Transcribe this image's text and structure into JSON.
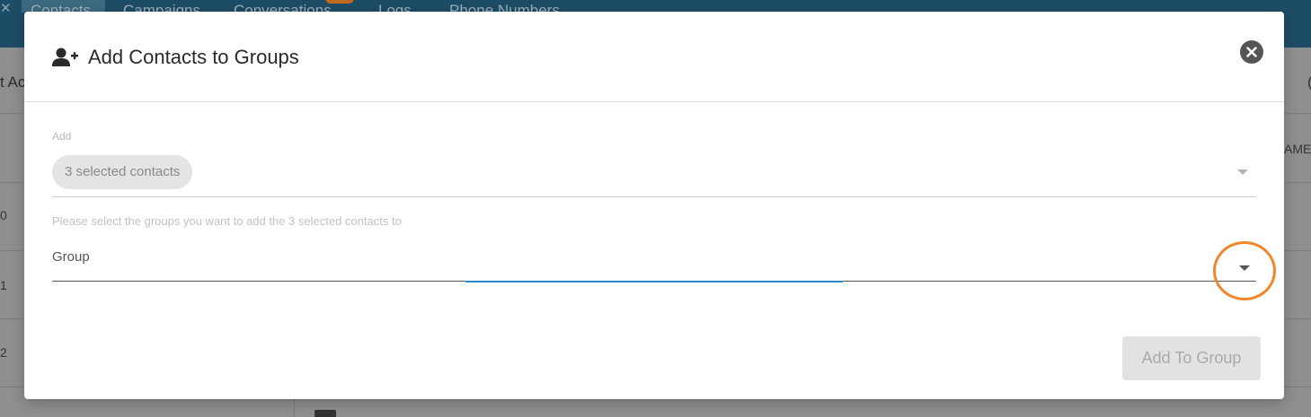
{
  "background": {
    "nav": [
      "Contacts",
      "Campaigns",
      "Conversations",
      "Logs",
      "Phone Numbers"
    ],
    "left_fragment": "t Ac",
    "right_fragment": "AME",
    "row_numbers": [
      "0",
      "1",
      "2"
    ],
    "right_edge_fragment": "("
  },
  "modal": {
    "title": "Add Contacts to Groups",
    "header_icon": "user-plus-icon",
    "close_icon": "close-icon",
    "add_label": "Add",
    "selected_chip": "3 selected contacts",
    "helper_text": "Please select the groups you want to add the 3 selected contacts to",
    "group_label": "Group",
    "submit_label": "Add To Group"
  },
  "colors": {
    "nav_bar": "#1d4d66",
    "focus_accent": "#2e86c8",
    "highlight": "#f0862a"
  }
}
